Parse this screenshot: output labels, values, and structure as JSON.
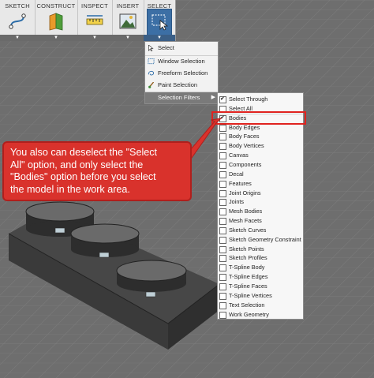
{
  "toolbar": {
    "groups": [
      {
        "label": "SKETCH",
        "icon": "sketch-curve-icon"
      },
      {
        "label": "CONSTRUCT",
        "icon": "construct-plane-icon"
      },
      {
        "label": "INSPECT",
        "icon": "measure-icon"
      },
      {
        "label": "INSERT",
        "icon": "insert-image-icon"
      },
      {
        "label": "SELECT",
        "icon": "select-window-icon",
        "active": true
      }
    ],
    "dropdown_glyph": "▼"
  },
  "select_menu": {
    "items": [
      {
        "label": "Select",
        "icon": "cursor-icon"
      },
      {
        "label": "Window Selection",
        "icon": "window-select-icon"
      },
      {
        "label": "Freeform Selection",
        "icon": "lasso-icon"
      },
      {
        "label": "Paint Selection",
        "icon": "paint-brush-icon"
      },
      {
        "label": "Selection Filters",
        "icon": "",
        "submenu_glyph": "▶"
      }
    ]
  },
  "filter_menu": {
    "items": [
      {
        "label": "Select Through",
        "checked": true
      },
      {
        "label": "Select All",
        "checked": false
      },
      {
        "label": "Bodies",
        "checked": true
      },
      {
        "label": "Body Edges",
        "checked": false
      },
      {
        "label": "Body Faces",
        "checked": false
      },
      {
        "label": "Body Vertices",
        "checked": false
      },
      {
        "label": "Canvas",
        "checked": false
      },
      {
        "label": "Components",
        "checked": false
      },
      {
        "label": "Decal",
        "checked": false
      },
      {
        "label": "Features",
        "checked": false
      },
      {
        "label": "Joint Origins",
        "checked": false
      },
      {
        "label": "Joints",
        "checked": false
      },
      {
        "label": "Mesh Bodies",
        "checked": false
      },
      {
        "label": "Mesh Facets",
        "checked": false
      },
      {
        "label": "Sketch Curves",
        "checked": false
      },
      {
        "label": "Sketch Geometry Constraint",
        "checked": false
      },
      {
        "label": "Sketch Points",
        "checked": false
      },
      {
        "label": "Sketch Profiles",
        "checked": false
      },
      {
        "label": "T-Spline Body",
        "checked": false
      },
      {
        "label": "T-Spline Edges",
        "checked": false
      },
      {
        "label": "T-Spline Faces",
        "checked": false
      },
      {
        "label": "T-Spline Vertices",
        "checked": false
      },
      {
        "label": "Text Selection",
        "checked": false
      },
      {
        "label": "Work Geometry",
        "checked": false
      }
    ]
  },
  "callout": {
    "lines": [
      "You also can deselect the \"Select",
      "All\" option, and only select the",
      "\"Bodies\" option before you select",
      "the model in the work area."
    ]
  },
  "colors": {
    "highlight_red": "#e0231f",
    "callout_red": "#d9322c",
    "active_blue": "#3c6fa5"
  }
}
